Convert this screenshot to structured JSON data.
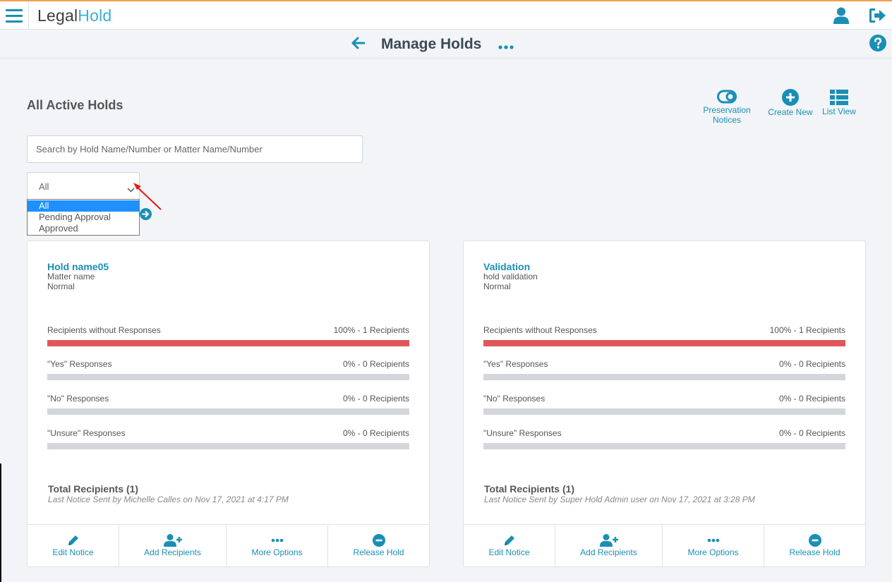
{
  "app": {
    "logo_part1": "Legal",
    "logo_part2": "Hold"
  },
  "header": {
    "title": "Manage Holds"
  },
  "section": {
    "title": "All Active Holds"
  },
  "actions": {
    "preservation_line1": "Preservation",
    "preservation_line2": "Notices",
    "create_new": "Create New",
    "list_view": "List View"
  },
  "search": {
    "placeholder": "Search by Hold Name/Number or Matter Name/Number",
    "value": ""
  },
  "filter": {
    "selected": "All",
    "options": [
      "All",
      "Pending Approval",
      "Approved"
    ]
  },
  "colors": {
    "accent": "#1a8fb5",
    "no_response_bar": "#e0575b",
    "empty_bar": "#d3d6da"
  },
  "cards": [
    {
      "title": "Hold name05",
      "matter": "Matter name",
      "priority": "Normal",
      "stats": [
        {
          "label": "Recipients without Responses",
          "value": "100% - 1 Recipients",
          "fill": 1.0
        },
        {
          "label": "\"Yes\" Responses",
          "value": "0% - 0 Recipients",
          "fill": 0
        },
        {
          "label": "\"No\" Responses",
          "value": "0% - 0 Recipients",
          "fill": 0
        },
        {
          "label": "\"Unsure\" Responses",
          "value": "0% - 0 Recipients",
          "fill": 0
        }
      ],
      "total": "Total Recipients (1)",
      "last_sent": "Last Notice Sent by Michelle Calles on Nov 17, 2021 at 4:17 PM",
      "buttons": {
        "edit": "Edit Notice",
        "add": "Add Recipients",
        "more": "More Options",
        "release": "Release Hold"
      }
    },
    {
      "title": "Validation",
      "matter": "hold validation",
      "priority": "Normal",
      "stats": [
        {
          "label": "Recipients without Responses",
          "value": "100% - 1 Recipients",
          "fill": 1.0
        },
        {
          "label": "\"Yes\" Responses",
          "value": "0% - 0 Recipients",
          "fill": 0
        },
        {
          "label": "\"No\" Responses",
          "value": "0% - 0 Recipients",
          "fill": 0
        },
        {
          "label": "\"Unsure\" Responses",
          "value": "0% - 0 Recipients",
          "fill": 0
        }
      ],
      "total": "Total Recipients (1)",
      "last_sent": "Last Notice Sent by Super Hold Admin user on Nov 17, 2021 at 3:28 PM",
      "buttons": {
        "edit": "Edit Notice",
        "add": "Add Recipients",
        "more": "More Options",
        "release": "Release Hold"
      }
    }
  ]
}
